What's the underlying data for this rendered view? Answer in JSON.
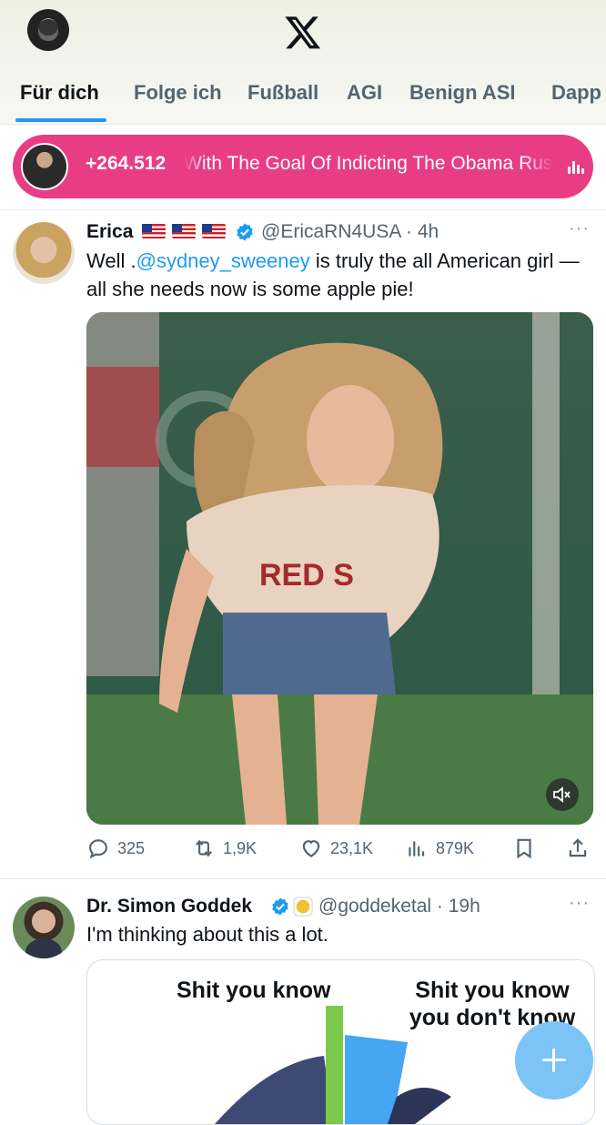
{
  "header": {
    "logo": "x-logo-icon",
    "tabs": [
      {
        "label": "Für dich",
        "active": true
      },
      {
        "label": "Folge ich"
      },
      {
        "label": "Fußball"
      },
      {
        "label": "AGI"
      },
      {
        "label": "Benign ASI"
      },
      {
        "label": "Dapp"
      }
    ]
  },
  "space": {
    "count": "+264.512",
    "title": "With The Goal Of Indicting The Obama Russia",
    "icon": "audio-bars-icon",
    "color": "#e83d84"
  },
  "posts": [
    {
      "name": "Erica",
      "flags": 3,
      "handle": "@EricaRN4USA",
      "time": "4h",
      "text_pre": "Well .",
      "mention": "@sydney_sweeney",
      "text_post": " is truly the all American girl — all she needs now is some apple pie!",
      "media_shirt_text": "RED S",
      "actions": {
        "replies": "325",
        "reposts": "1,9K",
        "likes": "23,1K",
        "views": "879K"
      }
    },
    {
      "name": "Dr. Simon Goddek",
      "handle": "@goddeketal",
      "time": "19h",
      "text": "I'm thinking about this a lot.",
      "chart_labels": {
        "left": "Shit you know",
        "right_line1": "Shit you know",
        "right_line2": "you don't know"
      }
    }
  ],
  "colors": {
    "accent": "#1d9bf0",
    "text": "#0f1419",
    "muted": "#536471"
  }
}
